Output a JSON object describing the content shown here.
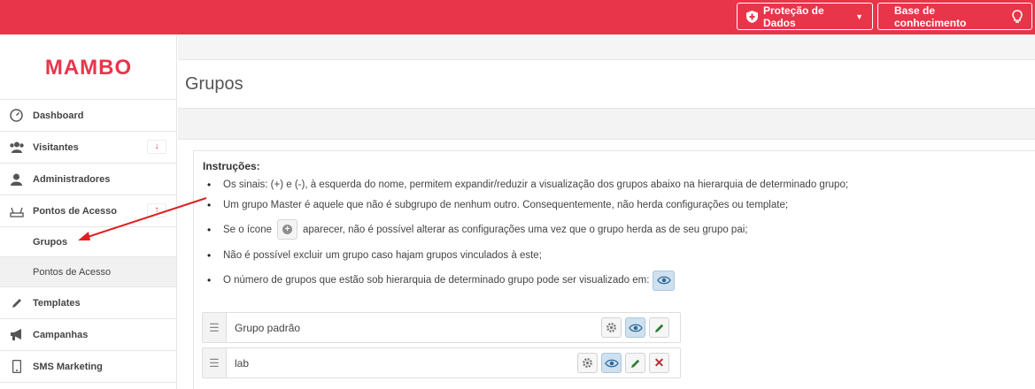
{
  "header": {
    "protecao_label": "Proteção de Dados",
    "base_label": "Base de conhecimento"
  },
  "brand": {
    "logo_text": "MAMBO"
  },
  "sidebar": {
    "items": [
      {
        "label": "Dashboard",
        "icon": "dashboard-icon"
      },
      {
        "label": "Visitantes",
        "icon": "users-icon",
        "badge": "↓"
      },
      {
        "label": "Administradores",
        "icon": "user-icon"
      },
      {
        "label": "Pontos de Acesso",
        "icon": "router-icon",
        "badge": "↑"
      },
      {
        "label": "Templates",
        "icon": "pencil-icon"
      },
      {
        "label": "Campanhas",
        "icon": "megaphone-icon"
      },
      {
        "label": "SMS Marketing",
        "icon": "phone-icon"
      }
    ],
    "subitems": [
      {
        "label": "Grupos"
      },
      {
        "label": "Pontos de Acesso"
      }
    ]
  },
  "page": {
    "title": "Grupos"
  },
  "instructions": {
    "title": "Instruções:",
    "items": [
      "Os sinais: (+) e (-), à esquerda do nome, permitem expandir/reduzir a visualização dos grupos abaixo na hierarquia de determinado grupo;",
      "Um grupo Master é aquele que não é subgrupo de nenhum outro. Consequentemente, não herda configurações ou template;",
      "aparecer, não é possível alterar as configurações uma vez que o grupo herda as de seu grupo pai;",
      "Não é possível excluir um grupo caso hajam grupos vinculados à este;",
      "O número de grupos que estão sob hierarquia de determinado grupo pode ser visualizado em:"
    ],
    "item3_prefix": "Se o ícone"
  },
  "groups": [
    {
      "name": "Grupo padrão",
      "drag": "☰"
    },
    {
      "name": "lab",
      "drag": "☰"
    }
  ],
  "colors": {
    "brand": "#e8354a",
    "eye_bg": "#cfe0ef",
    "edit": "#2e7d32",
    "delete": "#b03030"
  }
}
